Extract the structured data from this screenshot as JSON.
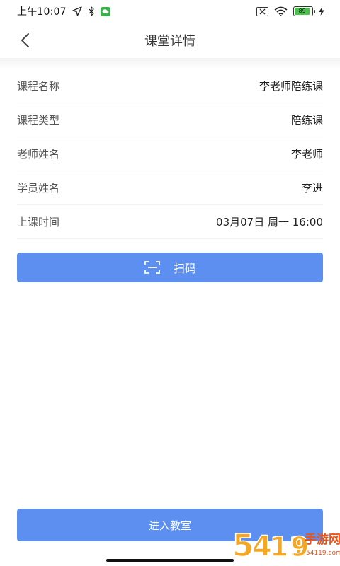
{
  "status_bar": {
    "time": "上午10:07",
    "battery_level": "89",
    "battery_percent": 89
  },
  "nav": {
    "title": "课堂详情"
  },
  "info": [
    {
      "label": "课程名称",
      "value": "李老师陪练课"
    },
    {
      "label": "课程类型",
      "value": "陪练课"
    },
    {
      "label": "老师姓名",
      "value": "李老师"
    },
    {
      "label": "学员姓名",
      "value": "李进"
    },
    {
      "label": "上课时间",
      "value": "03月07日 周一 16:00"
    }
  ],
  "scan_button": {
    "label": "扫码",
    "icon": "scan-icon"
  },
  "enter_button": {
    "label": "进入教室"
  },
  "watermark": {
    "text": "54119手游网",
    "domain": "www.54119.com"
  },
  "colors": {
    "primary": "#5c8ff0",
    "battery": "#49c24b",
    "wechat": "#36b24a"
  }
}
